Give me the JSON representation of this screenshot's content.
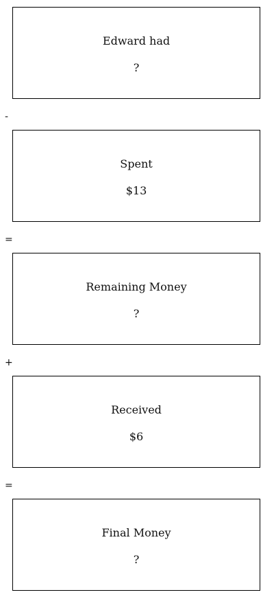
{
  "steps": [
    {
      "label": "Edward had",
      "value": "?"
    },
    {
      "label": "Spent",
      "value": "$13"
    },
    {
      "label": "Remaining Money",
      "value": "?"
    },
    {
      "label": "Received",
      "value": "$6"
    },
    {
      "label": "Final Money",
      "value": "?"
    }
  ],
  "operators": [
    "-",
    "=",
    "+",
    "="
  ]
}
